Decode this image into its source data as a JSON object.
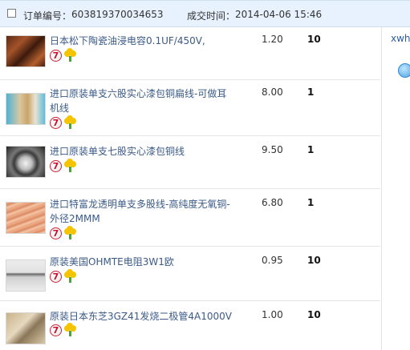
{
  "order": {
    "label_order_no": "订单编号：",
    "order_no": "603819370034653",
    "label_deal_time": "成交时间：",
    "deal_time": "2014-04-06 15:46"
  },
  "sidebar_right": {
    "link_text": "xwh"
  },
  "badge_seven_text": "7",
  "items": [
    {
      "title": "日本松下陶瓷油浸电容0.1UF/450V,",
      "price": "1.20",
      "quantity": "10"
    },
    {
      "title": "进口原装单支六股实心漆包铜扁线-可做耳机线",
      "price": "8.00",
      "quantity": "1"
    },
    {
      "title": "进口原装单支七股实心漆包铜线",
      "price": "9.50",
      "quantity": "1"
    },
    {
      "title": "进口特富龙透明单支多股线-高纯度无氧铜-外径2MMM",
      "price": "6.80",
      "quantity": "1"
    },
    {
      "title": "原装美国OHMTE电阻3W1欧",
      "price": "0.95",
      "quantity": "10"
    },
    {
      "title": "原装日本东芝3GZ41发烧二极管4A1000V",
      "price": "1.00",
      "quantity": "10"
    }
  ],
  "colors": {
    "header_bg": "#e8f2ff",
    "link_blue": "#3a5a88"
  }
}
